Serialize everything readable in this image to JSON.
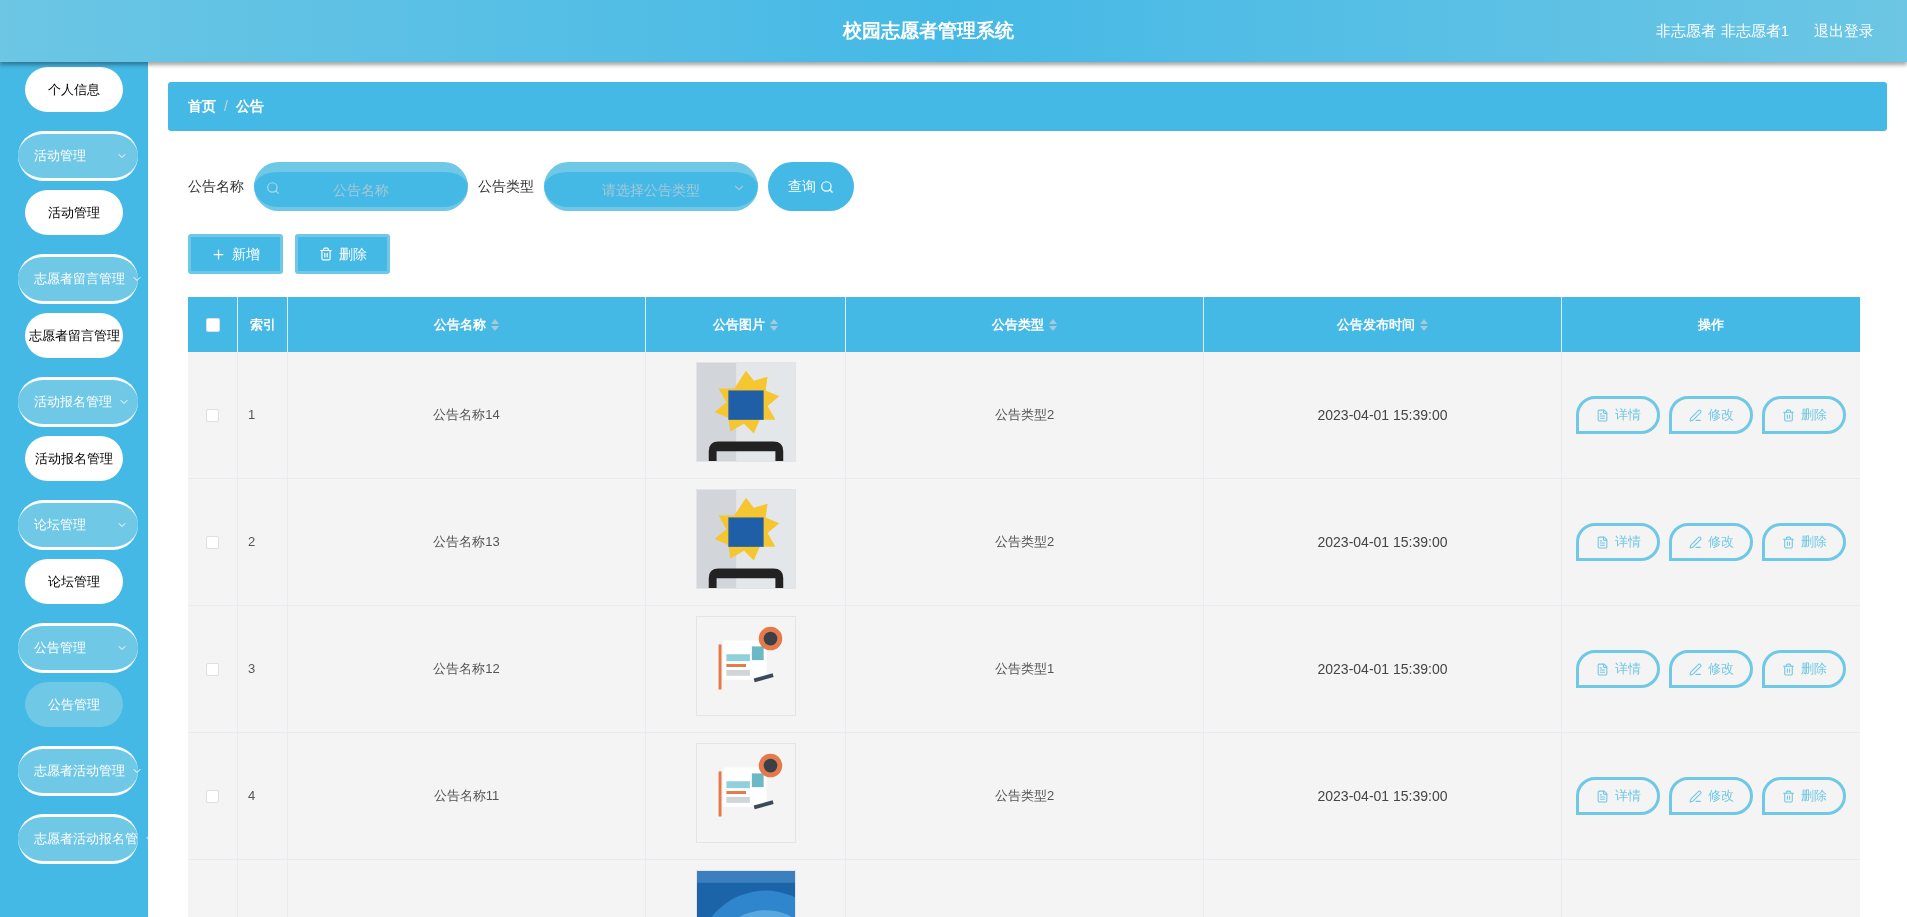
{
  "header": {
    "title": "校园志愿者管理系统",
    "user": "非志愿者 非志愿者1",
    "logout": "退出登录"
  },
  "menu": [
    {
      "kind": "item",
      "label": "个人信息",
      "selected": false
    },
    {
      "kind": "group",
      "label": "活动管理",
      "children": [
        {
          "label": "活动管理",
          "selected": false
        }
      ]
    },
    {
      "kind": "group",
      "label": "志愿者留言管理",
      "children": [
        {
          "label": "志愿者留言管理",
          "selected": false
        }
      ]
    },
    {
      "kind": "group",
      "label": "活动报名管理",
      "children": [
        {
          "label": "活动报名管理",
          "selected": false
        }
      ]
    },
    {
      "kind": "group",
      "label": "论坛管理",
      "children": [
        {
          "label": "论坛管理",
          "selected": false
        }
      ]
    },
    {
      "kind": "group",
      "label": "公告管理",
      "children": [
        {
          "label": "公告管理",
          "selected": true
        }
      ]
    },
    {
      "kind": "group",
      "label": "志愿者活动管理"
    },
    {
      "kind": "group",
      "label": "志愿者活动报名管"
    }
  ],
  "breadcrumb": [
    "首页",
    "公告"
  ],
  "breadcrumb_separator": "/",
  "search": {
    "fields": [
      {
        "label": "公告名称",
        "kind": "input",
        "placeholder": "公告名称"
      },
      {
        "label": "公告类型",
        "kind": "select",
        "placeholder": "请选择公告类型"
      }
    ],
    "button": "查询"
  },
  "toolbar": [
    {
      "kind": "add",
      "label": "新增"
    },
    {
      "kind": "delete",
      "label": "删除"
    }
  ],
  "table": {
    "select_all_checked": false,
    "columns": [
      {
        "label": "索引",
        "sortable": false
      },
      {
        "label": "公告名称",
        "sortable": true
      },
      {
        "label": "公告图片",
        "sortable": true
      },
      {
        "label": "公告类型",
        "sortable": true
      },
      {
        "label": "公告发布时间",
        "sortable": true
      },
      {
        "label": "操作",
        "sortable": false
      }
    ],
    "rows": [
      {
        "checked": false,
        "index": "1",
        "name": "公告名称14",
        "image": {
          "kind": "picture"
        },
        "type": "公告类型2",
        "time": "2023-04-01 15:39:00",
        "actions": [
          "详情",
          "修改",
          "删除"
        ]
      },
      {
        "checked": false,
        "index": "2",
        "name": "公告名称13",
        "image": {
          "kind": "picture"
        },
        "type": "公告类型2",
        "time": "2023-04-01 15:39:00",
        "actions": [
          "详情",
          "修改",
          "删除"
        ]
      },
      {
        "checked": false,
        "index": "3",
        "name": "公告名称12",
        "image": {
          "kind": "picture"
        },
        "type": "公告类型1",
        "time": "2023-04-01 15:39:00",
        "actions": [
          "详情",
          "修改",
          "删除"
        ]
      },
      {
        "checked": false,
        "index": "4",
        "name": "公告名称11",
        "image": {
          "kind": "picture"
        },
        "type": "公告类型2",
        "time": "2023-04-01 15:39:00",
        "actions": [
          "详情",
          "修改",
          "删除"
        ]
      },
      {
        "image": {
          "kind": "picture"
        }
      }
    ]
  }
}
